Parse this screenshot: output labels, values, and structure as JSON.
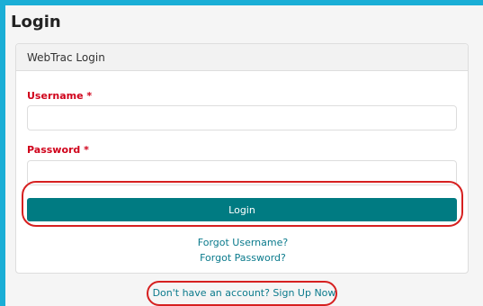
{
  "page": {
    "title": "Login"
  },
  "panel": {
    "heading": "WebTrac Login"
  },
  "form": {
    "username_label": "Username *",
    "username_value": "",
    "password_label": "Password *",
    "password_value": "",
    "login_label": "Login"
  },
  "links": {
    "forgot_username": "Forgot Username?",
    "forgot_password": "Forgot Password?",
    "signup": "Don't have an account? Sign Up Now"
  },
  "colors": {
    "frame": "#1aaed6",
    "button": "#007b82",
    "required_label": "#d0021b",
    "link": "#0a7a8c",
    "highlight": "#d62020"
  }
}
